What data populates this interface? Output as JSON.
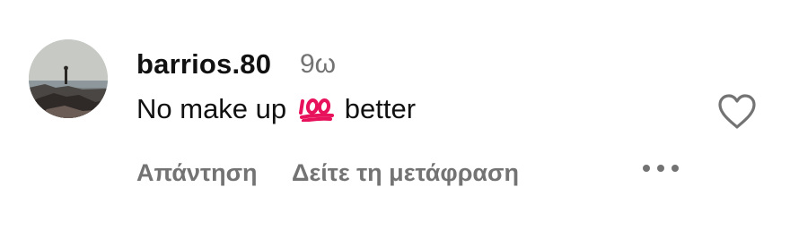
{
  "comment": {
    "username": "barrios.80",
    "time": "9ω",
    "text_before": "No make up",
    "emoji": "💯",
    "text_after": "better",
    "actions": {
      "reply": "Απάντηση",
      "translate": "Δείτε τη μετάφραση"
    }
  },
  "icons": {
    "avatar": "profile-photo",
    "emoji": "hundred-points-icon",
    "like": "heart-outline-icon",
    "more": "ellipsis-icon"
  },
  "colors": {
    "primary_text": "#111111",
    "secondary_text": "#737373",
    "emoji_red": "#e8115b"
  }
}
